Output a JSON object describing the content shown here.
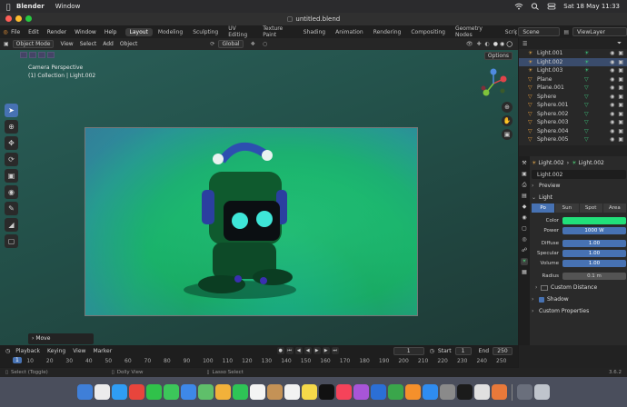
{
  "macos": {
    "app_name": "Blender",
    "menu": [
      "Window"
    ],
    "datetime": "Sat 18 May  11:33"
  },
  "window": {
    "title": "untitled.blend"
  },
  "topmenu": {
    "items": [
      "File",
      "Edit",
      "Render",
      "Window",
      "Help"
    ],
    "workspaces": [
      "Layout",
      "Modeling",
      "Sculpting",
      "UV Editing",
      "Texture Paint",
      "Shading",
      "Animation",
      "Rendering",
      "Compositing",
      "Geometry Nodes",
      "Script"
    ],
    "scene": "Scene",
    "view_layer": "ViewLayer"
  },
  "viewport": {
    "mode": "Object Mode",
    "menus": [
      "View",
      "Select",
      "Add",
      "Object"
    ],
    "transform": "Global",
    "options": "Options",
    "camera_label": "Camera Perspective",
    "collection_label": "(1) Collection | Light.002",
    "last_op": "Move"
  },
  "timeline": {
    "menus": [
      "Playback",
      "Keying",
      "View",
      "Marker"
    ],
    "current_frame": "1",
    "start_label": "Start",
    "start": "1",
    "end_label": "End",
    "end": "250",
    "ticks": [
      "1",
      "10",
      "20",
      "30",
      "40",
      "50",
      "60",
      "70",
      "80",
      "90",
      "100",
      "110",
      "120",
      "130",
      "140",
      "150",
      "160",
      "170",
      "180",
      "190",
      "200",
      "210",
      "220",
      "230",
      "240",
      "250"
    ]
  },
  "statusbar": {
    "select": "Select (Toggle)",
    "dolly": "Dolly View",
    "lasso": "Lasso Select",
    "version": "3.6.2"
  },
  "outliner": {
    "items": [
      {
        "name": "Light.001",
        "icon": "light"
      },
      {
        "name": "Light.002",
        "icon": "light",
        "selected": true
      },
      {
        "name": "Light.003",
        "icon": "light"
      },
      {
        "name": "Plane",
        "icon": "mesh"
      },
      {
        "name": "Plane.001",
        "icon": "mesh"
      },
      {
        "name": "Sphere",
        "icon": "mesh"
      },
      {
        "name": "Sphere.001",
        "icon": "mesh"
      },
      {
        "name": "Sphere.002",
        "icon": "mesh"
      },
      {
        "name": "Sphere.003",
        "icon": "mesh"
      },
      {
        "name": "Sphere.004",
        "icon": "mesh"
      },
      {
        "name": "Sphere.005",
        "icon": "mesh"
      }
    ]
  },
  "properties": {
    "crumb_object": "Light.002",
    "crumb_data": "Light.002",
    "name": "Light.002",
    "section_preview": "Preview",
    "section_light": "Light",
    "types": [
      "Po",
      "Sun",
      "Spot",
      "Area"
    ],
    "color_label": "Color",
    "power_label": "Power",
    "power": "1000 W",
    "diffuse_label": "Diffuse",
    "diffuse": "1.00",
    "specular_label": "Specular",
    "specular": "1.00",
    "volume_label": "Volume",
    "volume": "1.00",
    "radius_label": "Radius",
    "radius": "0.1 m",
    "custom_distance": "Custom Distance",
    "shadow": "Shadow",
    "custom_properties": "Custom Properties",
    "light_color": "#21e07a"
  }
}
